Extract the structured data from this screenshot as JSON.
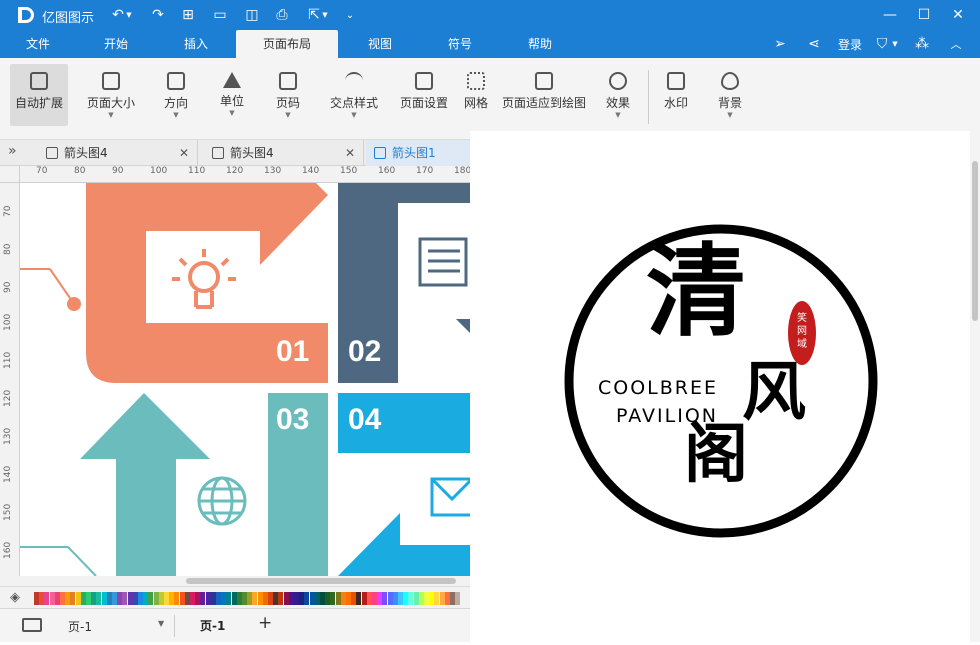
{
  "app": {
    "title": "亿图图示"
  },
  "titlebar": {
    "controls": [
      "minimize-icon",
      "maximize-icon",
      "close-icon"
    ]
  },
  "menu": {
    "items": [
      "文件",
      "开始",
      "插入",
      "页面布局",
      "视图",
      "符号",
      "帮助"
    ],
    "active": "页面布局",
    "login": "登录"
  },
  "ribbon": {
    "buttons": [
      {
        "label": "自动扩展",
        "active": true
      },
      {
        "label": "页面大小",
        "dropdown": true
      },
      {
        "label": "方向",
        "dropdown": true
      },
      {
        "label": "单位",
        "dropdown": true
      },
      {
        "label": "页码",
        "dropdown": true
      },
      {
        "label": "交点样式",
        "dropdown": true
      },
      {
        "label": "页面设置"
      },
      {
        "label": "网格"
      },
      {
        "label": "页面适应到绘图"
      },
      {
        "label": "效果",
        "dropdown": true
      },
      {
        "label": "水印"
      },
      {
        "label": "背景",
        "dropdown": true
      }
    ]
  },
  "tabs": [
    {
      "label": "箭头图4",
      "closable": true
    },
    {
      "label": "箭头图4",
      "closable": true
    },
    {
      "label": "箭头图1",
      "active": true
    }
  ],
  "ruler": {
    "h_ticks": [
      "70",
      "80",
      "90",
      "100",
      "110",
      "120",
      "130",
      "140",
      "150",
      "160",
      "170",
      "180"
    ],
    "v_ticks": [
      "70",
      "80",
      "90",
      "100",
      "110",
      "120",
      "130",
      "140",
      "150",
      "160"
    ]
  },
  "canvas": {
    "numbers": [
      "01",
      "02",
      "03",
      "04"
    ],
    "colors": {
      "orange": "#f08a68",
      "slate": "#4d6880",
      "teal": "#6bbdbd",
      "blue": "#1aace0"
    }
  },
  "preview": {
    "logo": {
      "big_chars": [
        "清",
        "风",
        "阁"
      ],
      "line1": "COOLBREE",
      "line2": "PAVILION",
      "seal": "笑网域"
    }
  },
  "status": {
    "page_select": "页-1",
    "page_tab": "页-1",
    "add": "+"
  },
  "palette": {
    "colors": [
      "#c0392b",
      "#e74c3c",
      "#e84393",
      "#f06292",
      "#ec407a",
      "#ff7043",
      "#f39c12",
      "#e67e22",
      "#f1c40f",
      "#27ae60",
      "#2ecc71",
      "#16a085",
      "#1abc9c",
      "#00bcd4",
      "#2980b9",
      "#3498db",
      "#8e44ad",
      "#9b59b6",
      "#5e35b1",
      "#3949ab",
      "#1e88e5",
      "#00acc1",
      "#43a047",
      "#7cb342",
      "#c0ca33",
      "#fdd835",
      "#ffb300",
      "#fb8c00",
      "#f4511e",
      "#6d4c41",
      "#d81b60",
      "#ad1457",
      "#6a1b9a",
      "#4527a0",
      "#283593",
      "#1565c0",
      "#0277bd",
      "#00838f",
      "#00695c",
      "#2e7d32",
      "#558b2f",
      "#9e9d24",
      "#f9a825",
      "#ff8f00",
      "#ef6c00",
      "#d84315",
      "#4e342e",
      "#bf360c",
      "#880e4f",
      "#4a148c",
      "#311b92",
      "#1a237e",
      "#0d47a1",
      "#01579b",
      "#006064",
      "#004d40",
      "#1b5e20",
      "#33691e",
      "#827717",
      "#f57f17",
      "#ff6f00",
      "#e65100",
      "#3e2723",
      "#b71c1c",
      "#ff5252",
      "#ff4081",
      "#e040fb",
      "#7c4dff",
      "#536dfe",
      "#448aff",
      "#40c4ff",
      "#18ffff",
      "#64ffda",
      "#69f0ae",
      "#b2ff59",
      "#eeff41",
      "#ffff00",
      "#ffd740",
      "#ffab40",
      "#ff6e40",
      "#8d6e63",
      "#bcaaa4"
    ]
  }
}
